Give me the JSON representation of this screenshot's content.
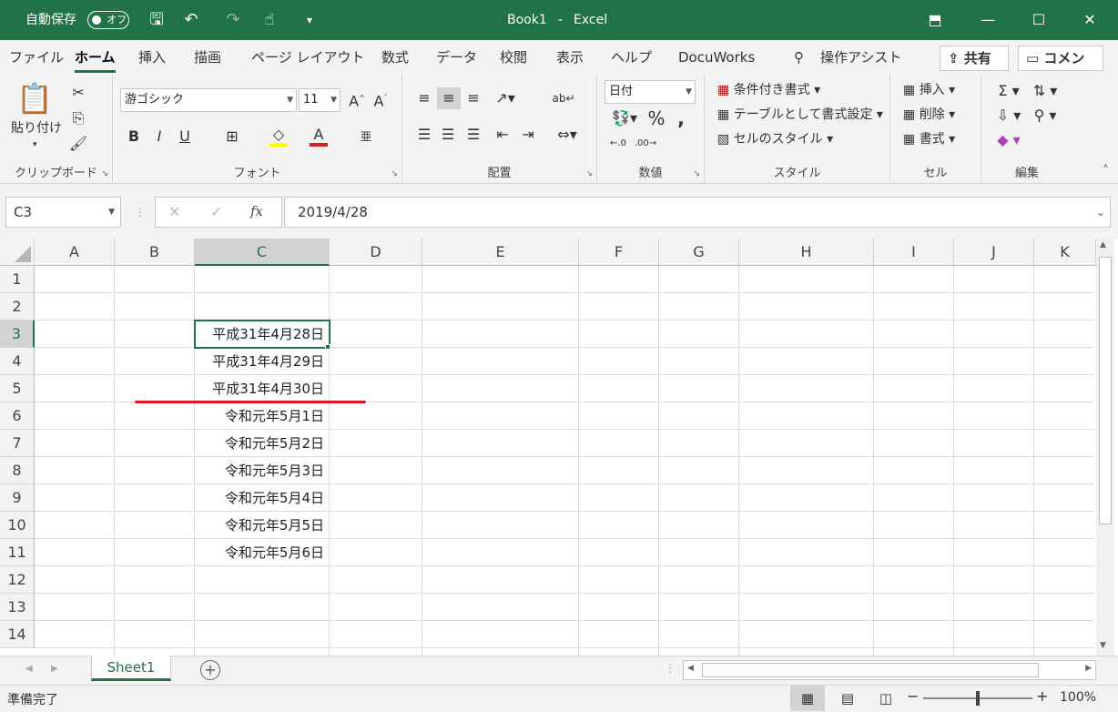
{
  "title": {
    "autosave_label": "自動保存",
    "autosave_state": "オフ",
    "doc_name": "Book1",
    "separator": "-",
    "app_name": "Excel"
  },
  "tabs": [
    "ファイル",
    "ホーム",
    "挿入",
    "描画",
    "ページ レイアウト",
    "数式",
    "データ",
    "校閲",
    "表示",
    "ヘルプ",
    "DocuWorks"
  ],
  "active_tab": "ホーム",
  "tell_me": "操作アシスト",
  "share_label": "共有",
  "comment_label": "コメント",
  "ribbon": {
    "clipboard": {
      "label": "クリップボード",
      "paste": "貼り付け"
    },
    "font": {
      "label": "フォント",
      "name": "游ゴシック",
      "size": "11",
      "bold": "B",
      "italic": "I",
      "underline": "U",
      "grow": "A^",
      "shrink": "Aˇ",
      "font_color": "A",
      "phonetic": "亜"
    },
    "alignment": {
      "label": "配置"
    },
    "number": {
      "label": "数値",
      "format": "日付",
      "percent": "%",
      "comma": ","
    },
    "styles": {
      "label": "スタイル",
      "conditional": "条件付き書式",
      "table": "テーブルとして書式設定",
      "cell_styles": "セルのスタイル"
    },
    "cells": {
      "label": "セル",
      "insert": "挿入",
      "delete": "削除",
      "format": "書式"
    },
    "editing": {
      "label": "編集"
    }
  },
  "formula_bar": {
    "name_box": "C3",
    "fx": "fx",
    "content": "2019/4/28"
  },
  "columns": [
    "A",
    "B",
    "C",
    "D",
    "E",
    "F",
    "G",
    "H",
    "I",
    "J",
    "K"
  ],
  "selected_column": "C",
  "rows": [
    "1",
    "2",
    "3",
    "4",
    "5",
    "6",
    "7",
    "8",
    "9",
    "10",
    "11",
    "12",
    "13",
    "14"
  ],
  "selected_row": "3",
  "cells": [
    {
      "row": "3",
      "value": "平成31年4月28日"
    },
    {
      "row": "4",
      "value": "平成31年4月29日"
    },
    {
      "row": "5",
      "value": "平成31年4月30日"
    },
    {
      "row": "6",
      "value": "令和元年5月1日"
    },
    {
      "row": "7",
      "value": "令和元年5月2日"
    },
    {
      "row": "8",
      "value": "令和元年5月3日"
    },
    {
      "row": "9",
      "value": "令和元年5月4日"
    },
    {
      "row": "10",
      "value": "令和元年5月5日"
    },
    {
      "row": "11",
      "value": "令和元年5月6日"
    }
  ],
  "sheet_tab": "Sheet1",
  "status": {
    "ready": "準備完了",
    "zoom": "100%",
    "zoom_level": 1.0
  },
  "colors": {
    "accent": "#217346",
    "annotation_line": "#e0182a",
    "font_color_bar": "#e01e1e",
    "highlight_bar": "#ffff00"
  }
}
